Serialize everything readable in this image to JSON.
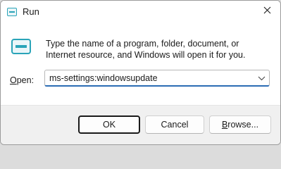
{
  "window": {
    "title": "Run"
  },
  "dialog": {
    "message": "Type the name of a program, folder, document, or Internet resource, and Windows will open it for you.",
    "open_label_mnemonic": "O",
    "open_label_rest": "pen:",
    "open_value": "ms-settings:windowsupdate"
  },
  "buttons": {
    "ok_label": "OK",
    "cancel_label": "Cancel",
    "browse_mnemonic": "B",
    "browse_rest": "rowse..."
  },
  "icons": {
    "title": "run-icon",
    "dialog": "run-icon",
    "close": "close-icon",
    "dropdown": "chevron-down-icon"
  },
  "colors": {
    "accent": "#2b6cb4",
    "icon_teal": "#2aa4b8"
  }
}
